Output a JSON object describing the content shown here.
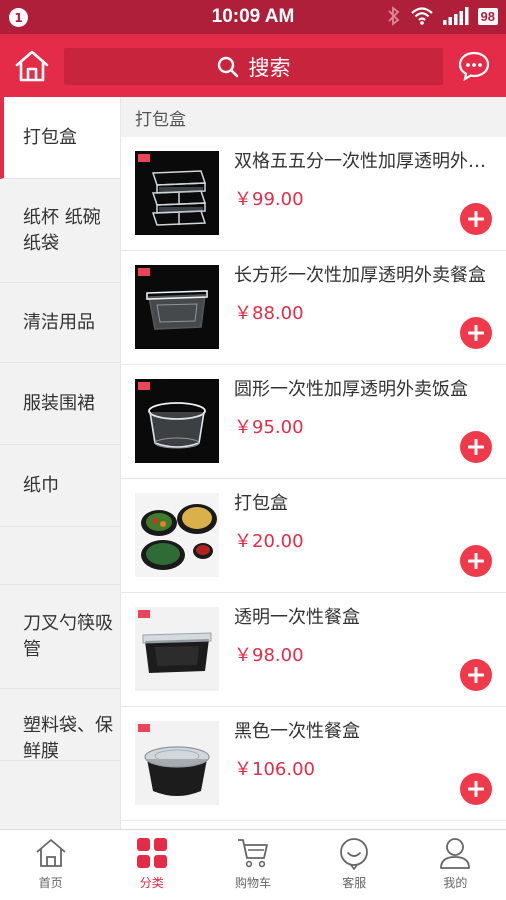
{
  "status_bar": {
    "notification_count": "1",
    "time": "10:09 AM",
    "battery": "98"
  },
  "header": {
    "search_placeholder": "搜索",
    "icons": [
      "home-icon",
      "search-icon",
      "message-icon"
    ]
  },
  "sidebar": {
    "items": [
      {
        "label": "打包盒",
        "active": true
      },
      {
        "label": "纸杯 纸碗 纸袋"
      },
      {
        "label": "清洁用品"
      },
      {
        "label": "服装围裙"
      },
      {
        "label": "纸巾"
      },
      {
        "label": ""
      },
      {
        "label": "刀叉勺筷吸管"
      },
      {
        "label": "塑料袋、保鲜膜"
      }
    ]
  },
  "content": {
    "section_title": "打包盒",
    "products": [
      {
        "name": "双格五五分一次性加厚透明外卖快餐盒",
        "price": "￥99.00"
      },
      {
        "name": "长方形一次性加厚透明外卖餐盒",
        "price": "￥88.00"
      },
      {
        "name": "圆形一次性加厚透明外卖饭盒",
        "price": "￥95.00"
      },
      {
        "name": "打包盒",
        "price": "￥20.00"
      },
      {
        "name": "透明一次性餐盒",
        "price": "￥98.00"
      },
      {
        "name": "黑色一次性餐盒",
        "price": "￥106.00"
      }
    ]
  },
  "tabbar": {
    "tabs": [
      {
        "label": "首页",
        "icon": "home-icon"
      },
      {
        "label": "分类",
        "icon": "category-icon",
        "active": true
      },
      {
        "label": "购物车",
        "icon": "cart-icon"
      },
      {
        "label": "客服",
        "icon": "service-icon"
      },
      {
        "label": "我的",
        "icon": "user-icon"
      }
    ]
  },
  "colors": {
    "status_bar": "#b01f3a",
    "header": "#e42c48",
    "accent": "#e42c48",
    "price": "#e42c48"
  }
}
